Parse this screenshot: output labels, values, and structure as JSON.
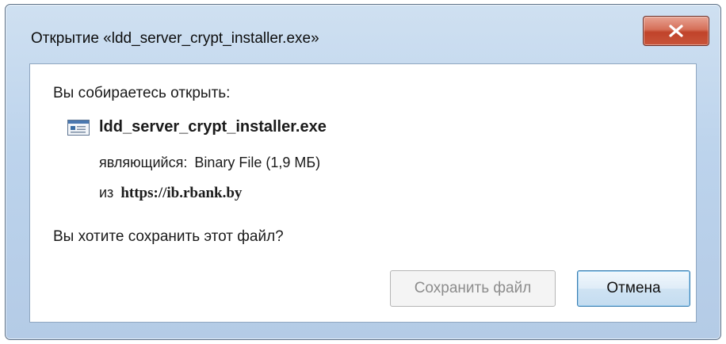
{
  "window": {
    "title": "Открытие «ldd_server_crypt_installer.exe»"
  },
  "dialog": {
    "prompt": "Вы собираетесь открыть:",
    "file_name": "ldd_server_crypt_installer.exe",
    "file_icon": "file-window-icon",
    "type_label": "являющийся:",
    "type_value": "Binary File (1,9 МБ)",
    "from_label": "из",
    "from_url": "https://ib.rbank.by",
    "question": "Вы хотите сохранить этот файл?"
  },
  "buttons": {
    "save_label": "Сохранить файл",
    "save_enabled": false,
    "cancel_label": "Отмена"
  },
  "colors": {
    "close_button": "#c9553b",
    "title_bar": "#bcd3ec",
    "cancel_border": "#3c7fb1"
  }
}
